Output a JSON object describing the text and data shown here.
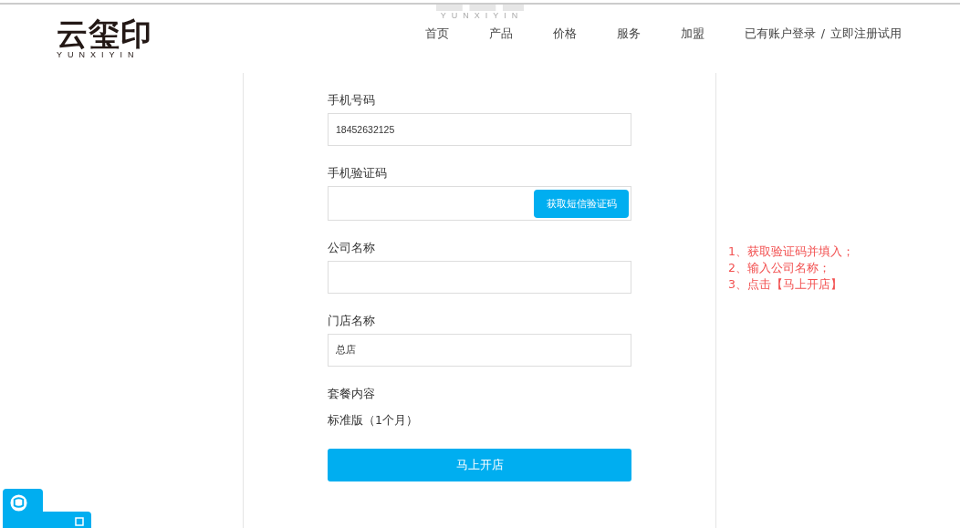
{
  "header": {
    "logo": {
      "title": "云玺印",
      "subtitle": "YUNXIYIN"
    },
    "ghost_logo": {
      "subtitle": "YUNXIYIN"
    },
    "nav": [
      {
        "label": "首页"
      },
      {
        "label": "产品"
      },
      {
        "label": "价格"
      },
      {
        "label": "服务"
      },
      {
        "label": "加盟"
      }
    ],
    "account": {
      "login": "已有账户登录",
      "separator": "/",
      "register": "立即注册试用"
    }
  },
  "form": {
    "fields": [
      {
        "kind": "input",
        "label": "手机号码",
        "value": "18452632125"
      },
      {
        "kind": "code",
        "label": "手机验证码",
        "button": "获取短信验证码"
      },
      {
        "kind": "input",
        "label": "公司名称"
      },
      {
        "kind": "input",
        "label": "门店名称",
        "value": "总店"
      },
      {
        "kind": "static",
        "label": "套餐内容",
        "value": "标准版（1个月）"
      }
    ],
    "submit": "马上开店"
  },
  "notes": [
    "1、获取验证码并填入；",
    "2、输入公司名称；",
    "3、点击【马上开店】"
  ]
}
